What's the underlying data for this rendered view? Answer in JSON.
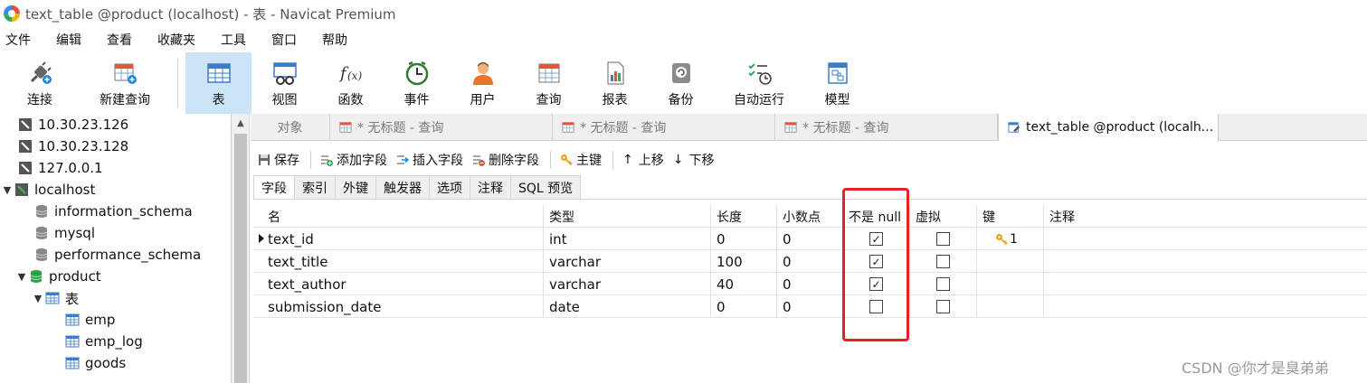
{
  "window": {
    "title": "text_table @product (localhost) - 表 - Navicat Premium"
  },
  "menu": [
    "文件",
    "编辑",
    "查看",
    "收藏夹",
    "工具",
    "窗口",
    "帮助"
  ],
  "toolbar": {
    "connect": "连接",
    "new_query": "新建查询",
    "table": "表",
    "view": "视图",
    "function": "函数",
    "event": "事件",
    "user": "用户",
    "query": "查询",
    "report": "报表",
    "backup": "备份",
    "automation": "自动运行",
    "model": "模型"
  },
  "sidebar": {
    "connections": [
      "10.30.23.126",
      "10.30.23.128",
      "127.0.0.1"
    ],
    "localhost": "localhost",
    "databases": [
      "information_schema",
      "mysql",
      "performance_schema"
    ],
    "product": "product",
    "tables_node": "表",
    "tables": [
      "emp",
      "emp_log",
      "goods"
    ]
  },
  "tabs": {
    "objects": "对象",
    "query_tab": "* 无标题 - 查询",
    "active": "text_table @product (localh..."
  },
  "editbar": {
    "save": "保存",
    "add_field": "添加字段",
    "insert_field": "插入字段",
    "delete_field": "删除字段",
    "primary_key": "主键",
    "move_up": "上移",
    "move_down": "下移"
  },
  "subtabs": [
    "字段",
    "索引",
    "外键",
    "触发器",
    "选项",
    "注释",
    "SQL 预览"
  ],
  "grid": {
    "headers": {
      "name": "名",
      "type": "类型",
      "length": "长度",
      "decimals": "小数点",
      "not_null": "不是 null",
      "virtual": "虚拟",
      "key": "键",
      "comment": "注释"
    },
    "rows": [
      {
        "name": "text_id",
        "type": "int",
        "length": "0",
        "decimals": "0",
        "not_null": true,
        "virtual": false,
        "key": "1"
      },
      {
        "name": "text_title",
        "type": "varchar",
        "length": "100",
        "decimals": "0",
        "not_null": true,
        "virtual": false,
        "key": ""
      },
      {
        "name": "text_author",
        "type": "varchar",
        "length": "40",
        "decimals": "0",
        "not_null": true,
        "virtual": false,
        "key": ""
      },
      {
        "name": "submission_date",
        "type": "date",
        "length": "0",
        "decimals": "0",
        "not_null": false,
        "virtual": false,
        "key": ""
      }
    ]
  },
  "watermark": "CSDN @你才是臭弟弟",
  "colors": {
    "highlight": "#e8202a",
    "active_tool": "#cce4f7"
  }
}
